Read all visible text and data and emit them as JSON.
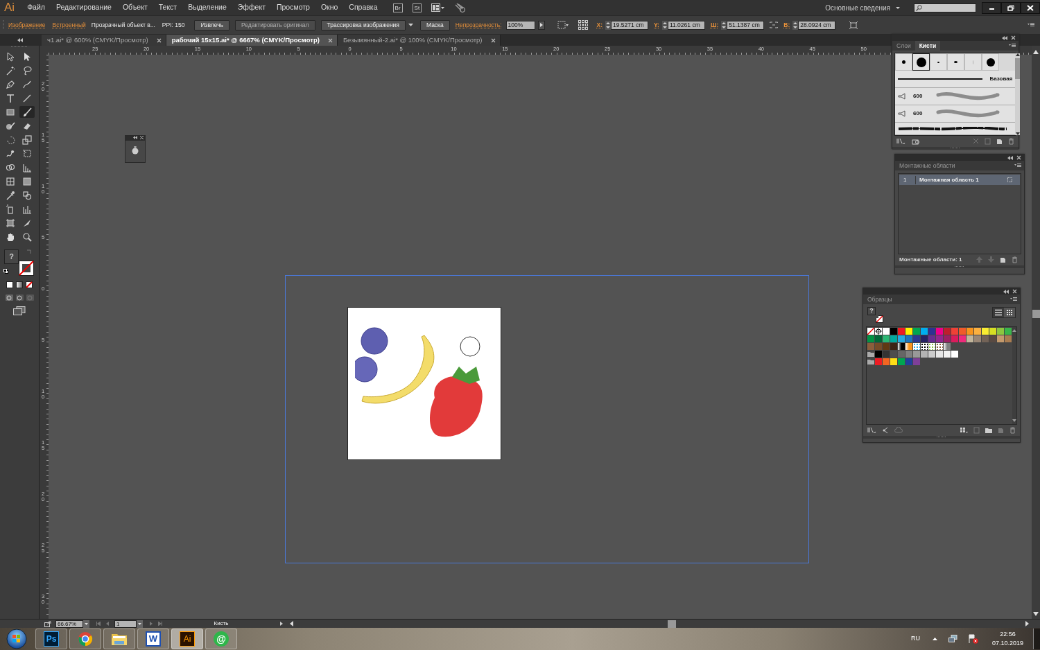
{
  "menu": {
    "logo": "Ai",
    "items": [
      "Файл",
      "Редактирование",
      "Объект",
      "Текст",
      "Выделение",
      "Эффект",
      "Просмотр",
      "Окно",
      "Справка"
    ],
    "app_buttons": [
      "Br",
      "St"
    ],
    "workspace": "Основные сведения"
  },
  "control_bar": {
    "items": [
      {
        "kind": "link",
        "label": "Изображение",
        "disabled": false
      },
      {
        "kind": "link",
        "label": "Встроенный",
        "disabled": false
      },
      {
        "kind": "text",
        "label": "Прозрачный объект в...",
        "disabled": false
      },
      {
        "kind": "text",
        "label": "PPI: 150",
        "disabled": false
      },
      {
        "kind": "button",
        "label": "Извлечь",
        "disabled": false
      },
      {
        "kind": "button",
        "label": "Редактировать оригинал",
        "disabled": true
      },
      {
        "kind": "dropdown",
        "label": "Трассировка изображения",
        "disabled": false
      },
      {
        "kind": "button",
        "label": "Маска",
        "disabled": false
      },
      {
        "kind": "link",
        "label": "Непрозрачность:",
        "disabled": false
      },
      {
        "kind": "field",
        "label": "100%",
        "disabled": false
      }
    ],
    "transform": [
      {
        "label": "X:",
        "value": "19.5271 cm"
      },
      {
        "label": "Y:",
        "value": "11.0261 cm"
      },
      {
        "label": "Ш:",
        "value": "51.1387 cm"
      },
      {
        "label": "В:",
        "value": "28.0924 cm"
      }
    ]
  },
  "doc_tabs": [
    {
      "label": "ч1.ai* @ 600% (CMYK/Просмотр)",
      "selected": false
    },
    {
      "label": "рабочий 15x15.ai* @  6667% (CMYK/Просмотр)",
      "selected": true
    },
    {
      "label": "Безымянный-2.ai* @ 100% (CMYK/Просмотр)",
      "selected": false
    }
  ],
  "rulers": {
    "horizontal": [
      "25",
      "20",
      "15",
      "10",
      "5",
      "0",
      "5",
      "10",
      "15",
      "20",
      "25",
      "30",
      "35",
      "40",
      "45",
      "50"
    ],
    "vertical": [
      "20",
      "15",
      "10",
      "5",
      "0",
      "5",
      "10",
      "15",
      "20",
      "25",
      "30"
    ]
  },
  "tools": [
    {
      "selected": false
    },
    {
      "selected": false
    },
    {
      "selected": false
    },
    {
      "selected": false
    },
    {
      "selected": false
    },
    {
      "selected": false
    },
    {
      "selected": false
    },
    {
      "selected": false
    },
    {
      "selected": false
    },
    {
      "selected": true
    },
    {
      "selected": false
    },
    {
      "selected": false
    },
    {
      "selected": false
    },
    {
      "selected": false
    },
    {
      "selected": false
    },
    {
      "selected": false
    },
    {
      "selected": false
    },
    {
      "selected": false
    },
    {
      "selected": false
    },
    {
      "selected": false
    },
    {
      "selected": false
    },
    {
      "selected": false
    },
    {
      "selected": false
    },
    {
      "selected": false
    },
    {
      "selected": false
    },
    {
      "selected": false
    },
    {
      "selected": false
    },
    {
      "selected": false
    }
  ],
  "fill_stroke": {
    "fill_label": "?"
  },
  "brushes_panel": {
    "tabs": [
      {
        "label": "Слои",
        "selected": false
      },
      {
        "label": "Кисти",
        "selected": true
      }
    ],
    "tips": [
      {
        "selected": false
      },
      {
        "selected": true
      },
      {
        "selected": false
      },
      {
        "selected": false
      },
      {
        "selected": false
      },
      {
        "selected": false
      }
    ],
    "brushes": [
      {
        "kind": "line",
        "label": "Базовая"
      },
      {
        "kind": "bristle",
        "label": "600"
      },
      {
        "kind": "bristle",
        "label": "600"
      },
      {
        "kind": "texture"
      }
    ]
  },
  "artboards_panel": {
    "title": "Монтажные области",
    "rows": [
      {
        "number": "1",
        "name": "Монтажная область 1",
        "selected": true
      }
    ],
    "footer": "Монтажные области: 1"
  },
  "swatches_panel": {
    "title": "Образцы",
    "fill_label": "?",
    "rows": [
      [
        {
          "kind": "none"
        },
        {
          "kind": "registration"
        },
        {
          "kind": "color",
          "color": "#ffffff"
        },
        {
          "kind": "color",
          "color": "#000000"
        },
        {
          "kind": "color",
          "color": "#ed1c24"
        },
        {
          "kind": "color",
          "color": "#fff200"
        },
        {
          "kind": "color",
          "color": "#00a651"
        },
        {
          "kind": "color",
          "color": "#00aeef"
        },
        {
          "kind": "color",
          "color": "#2e3192"
        },
        {
          "kind": "color",
          "color": "#ec008c"
        },
        {
          "kind": "color",
          "color": "#be1e2d"
        },
        {
          "kind": "color",
          "color": "#ef4136"
        },
        {
          "kind": "color",
          "color": "#f15a29"
        },
        {
          "kind": "color",
          "color": "#f7941d"
        },
        {
          "kind": "color",
          "color": "#fbb040"
        },
        {
          "kind": "color",
          "color": "#f9ed32"
        },
        {
          "kind": "color",
          "color": "#d7df23"
        },
        {
          "kind": "color",
          "color": "#8dc63f"
        },
        {
          "kind": "color",
          "color": "#39b54a"
        }
      ],
      [
        {
          "kind": "color",
          "color": "#009444"
        },
        {
          "kind": "color",
          "color": "#006838"
        },
        {
          "kind": "color",
          "color": "#2bb673"
        },
        {
          "kind": "color",
          "color": "#00a99d"
        },
        {
          "kind": "color",
          "color": "#27aae1"
        },
        {
          "kind": "color",
          "color": "#1c75bc"
        },
        {
          "kind": "color",
          "color": "#2b3990"
        },
        {
          "kind": "color",
          "color": "#262262"
        },
        {
          "kind": "color",
          "color": "#662d91"
        },
        {
          "kind": "color",
          "color": "#92278f"
        },
        {
          "kind": "color",
          "color": "#9e1f63"
        },
        {
          "kind": "color",
          "color": "#da1c5c"
        },
        {
          "kind": "color",
          "color": "#ee2a7b"
        },
        {
          "kind": "color",
          "color": "#c2b59b"
        },
        {
          "kind": "color",
          "color": "#998675"
        },
        {
          "kind": "color",
          "color": "#736357"
        },
        {
          "kind": "color",
          "color": "#594a42"
        },
        {
          "kind": "color",
          "color": "#c49a6c"
        },
        {
          "kind": "color",
          "color": "#a97c50"
        }
      ],
      [
        {
          "kind": "color",
          "color": "#8b5e3c"
        },
        {
          "kind": "color",
          "color": "#754c29"
        },
        {
          "kind": "color",
          "color": "#603913"
        },
        {
          "kind": "color",
          "color": "#3c2415"
        },
        {
          "kind": "gradient",
          "color": "#000000"
        },
        {
          "kind": "gradient",
          "color": "#f7941d"
        },
        {
          "kind": "pattern",
          "color": "#27aae1"
        },
        {
          "kind": "pattern",
          "color": "#000000"
        },
        {
          "kind": "pattern",
          "color": "#8dc63f"
        },
        {
          "kind": "pattern",
          "color": "#8b5e3c"
        },
        {
          "kind": "gradient",
          "color": "#808080"
        }
      ],
      [
        {
          "kind": "folder"
        },
        {
          "kind": "color",
          "color": "#000000"
        },
        {
          "kind": "color",
          "color": "#333333"
        },
        {
          "kind": "color",
          "color": "#4d4d4d"
        },
        {
          "kind": "color",
          "color": "#666666"
        },
        {
          "kind": "color",
          "color": "#808080"
        },
        {
          "kind": "color",
          "color": "#999999"
        },
        {
          "kind": "color",
          "color": "#b3b3b3"
        },
        {
          "kind": "color",
          "color": "#cccccc"
        },
        {
          "kind": "color",
          "color": "#e6e6e6"
        },
        {
          "kind": "color",
          "color": "#f2f2f2"
        },
        {
          "kind": "color",
          "color": "#ffffff"
        }
      ],
      [
        {
          "kind": "folder"
        },
        {
          "kind": "color",
          "color": "#ed1c24"
        },
        {
          "kind": "color",
          "color": "#f26522"
        },
        {
          "kind": "color",
          "color": "#ffde17"
        },
        {
          "kind": "color",
          "color": "#00a651"
        },
        {
          "kind": "color",
          "color": "#21409a"
        },
        {
          "kind": "color",
          "color": "#7f3f98"
        }
      ]
    ]
  },
  "status_bar": {
    "zoom": "66.67%",
    "page": "1",
    "tool": "Кисть"
  },
  "taskbar": {
    "apps": [
      {
        "kind": "ps",
        "label": "Ps",
        "active": false
      },
      {
        "kind": "chrome",
        "active": false
      },
      {
        "kind": "folder",
        "active": false
      },
      {
        "kind": "word",
        "label": "W",
        "active": false
      },
      {
        "kind": "ai",
        "label": "Ai",
        "active": true
      },
      {
        "kind": "mail",
        "label": "@",
        "active": false
      }
    ],
    "language": "RU",
    "time": "22:56",
    "date": "07.10.2019"
  }
}
